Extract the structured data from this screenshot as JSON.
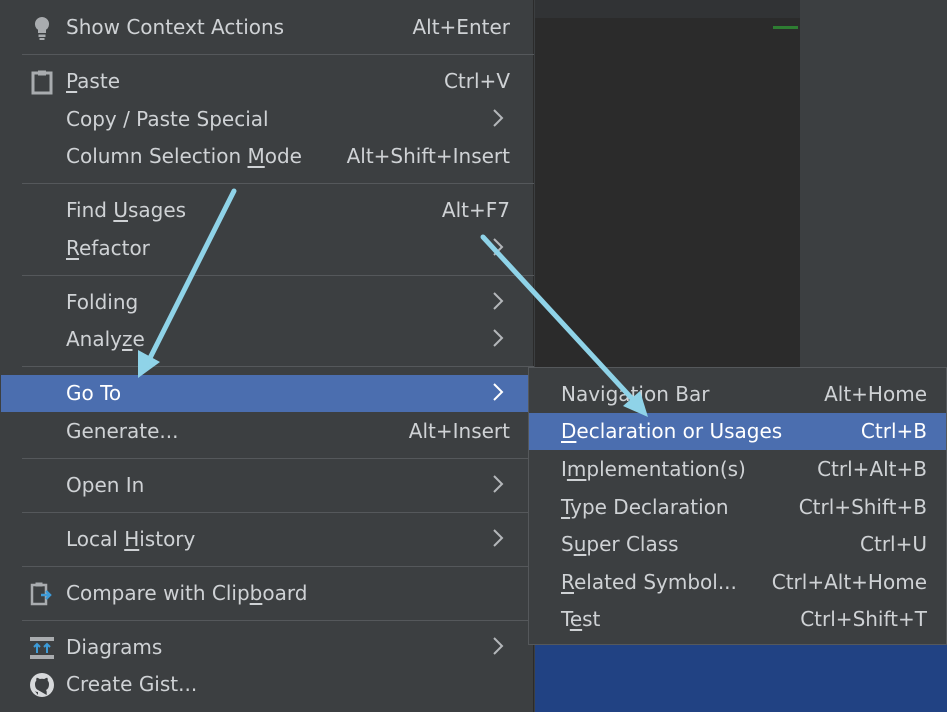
{
  "context_menu": {
    "items": [
      {
        "label": "Show Context Actions",
        "shortcut": "Alt+Enter",
        "icon": "lightbulb-icon"
      },
      {
        "label": "Paste",
        "shortcut": "Ctrl+V",
        "icon": "clipboard-icon"
      },
      {
        "label": "Copy / Paste Special",
        "shortcut": "",
        "submenu": true
      },
      {
        "label": "Column Selection Mode",
        "shortcut": "Alt+Shift+Insert"
      },
      {
        "label": "Find Usages",
        "shortcut": "Alt+F7"
      },
      {
        "label": "Refactor",
        "shortcut": "",
        "submenu": true
      },
      {
        "label": "Folding",
        "shortcut": "",
        "submenu": true
      },
      {
        "label": "Analyze",
        "shortcut": "",
        "submenu": true
      },
      {
        "label": "Go To",
        "shortcut": "",
        "submenu": true,
        "selected": true
      },
      {
        "label": "Generate...",
        "shortcut": "Alt+Insert"
      },
      {
        "label": "Open In",
        "shortcut": "",
        "submenu": true
      },
      {
        "label": "Local History",
        "shortcut": "",
        "submenu": true
      },
      {
        "label": "Compare with Clipboard",
        "shortcut": "",
        "icon": "compare-clipboard-icon"
      },
      {
        "label": "Diagrams",
        "shortcut": "",
        "submenu": true,
        "icon": "diagrams-icon"
      },
      {
        "label": "Create Gist...",
        "shortcut": "",
        "icon": "github-icon"
      }
    ]
  },
  "goto_submenu": {
    "items": [
      {
        "label": "Navigation Bar",
        "shortcut": "Alt+Home"
      },
      {
        "label": "Declaration or Usages",
        "shortcut": "Ctrl+B",
        "selected": true
      },
      {
        "label": "Implementation(s)",
        "shortcut": "Ctrl+Alt+B"
      },
      {
        "label": "Type Declaration",
        "shortcut": "Ctrl+Shift+B"
      },
      {
        "label": "Super Class",
        "shortcut": "Ctrl+U"
      },
      {
        "label": "Related Symbol...",
        "shortcut": "Ctrl+Alt+Home"
      },
      {
        "label": "Test",
        "shortcut": "Ctrl+Shift+T"
      }
    ]
  },
  "colors": {
    "menu_background": "#3c3f41",
    "selection": "#4b6eaf",
    "text": "#cfd2d5",
    "annotation_arrow": "#8fd3e8",
    "bottom_panel": "#214283"
  }
}
